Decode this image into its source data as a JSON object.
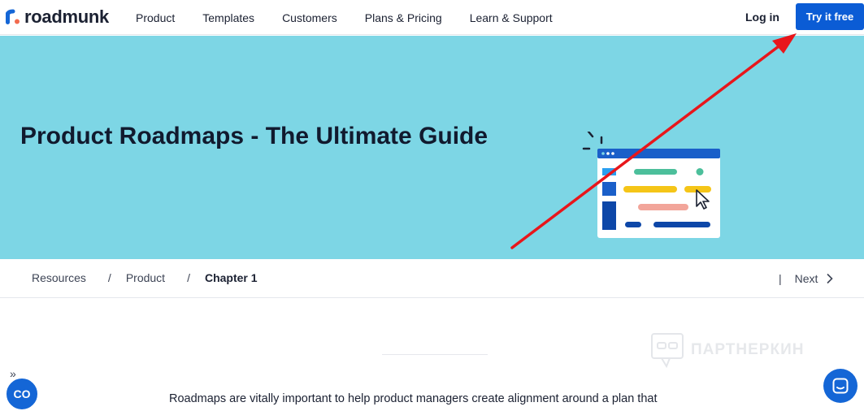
{
  "brand": {
    "name": "roadmunk"
  },
  "nav": {
    "links": [
      "Product",
      "Templates",
      "Customers",
      "Plans & Pricing",
      "Learn & Support"
    ],
    "login": "Log in",
    "cta": "Try it free"
  },
  "hero": {
    "title": "Product Roadmaps - The Ultimate Guide",
    "background": "#7dd6e5"
  },
  "breadcrumb": {
    "items": [
      "Resources",
      "Product",
      "Chapter 1"
    ],
    "separator": "/",
    "next_label": "Next"
  },
  "content": {
    "intro": "Roadmaps are vitally important to help product managers create alignment around a plan that"
  },
  "watermark": {
    "text": "ПАРТНЕРКИН"
  },
  "widgets": {
    "co_label": "CO",
    "collapse": "»"
  },
  "colors": {
    "primary": "#0b5cd5",
    "annotation": "#e8161b",
    "text": "#1b2132"
  }
}
